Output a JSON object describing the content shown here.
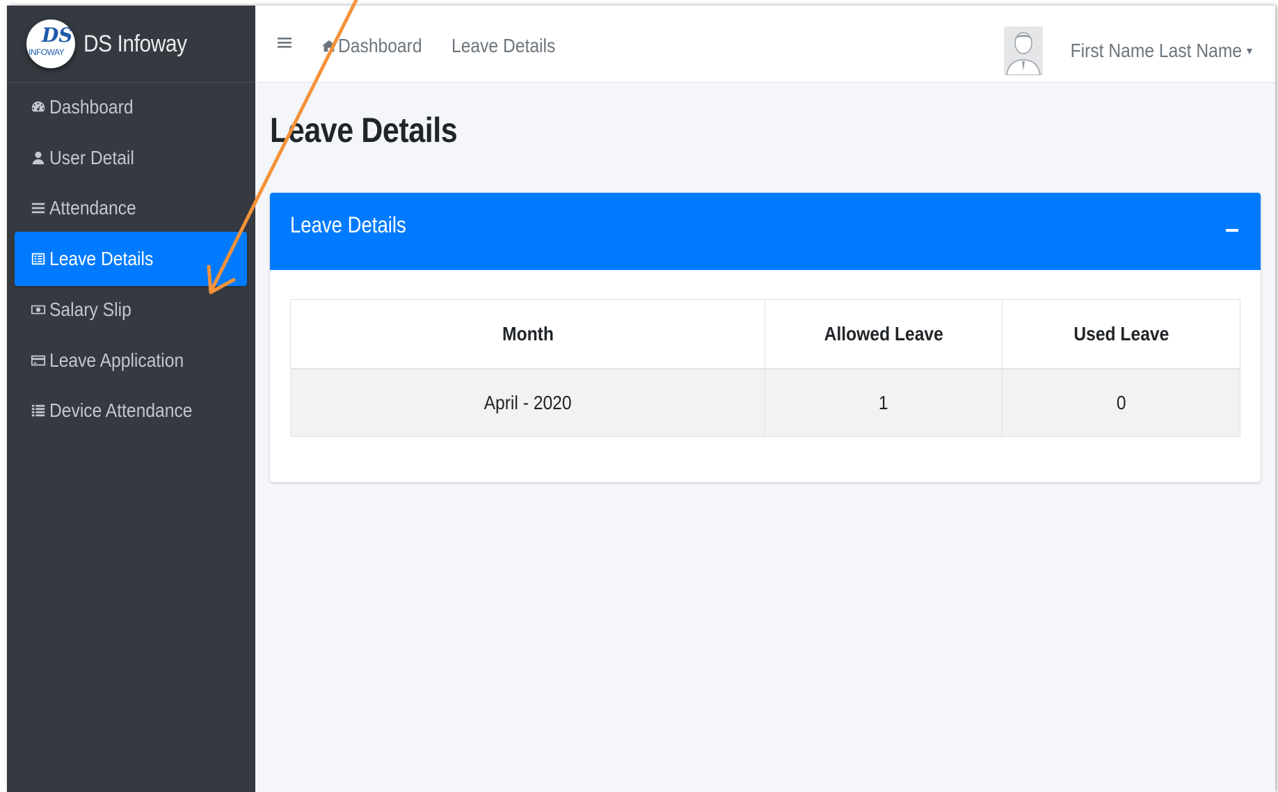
{
  "brand": {
    "name": "DS Infoway",
    "logo_top": "DS",
    "logo_bottom": "INFOWAY"
  },
  "sidebar": {
    "items": [
      {
        "label": "Dashboard",
        "icon": "tachometer-icon"
      },
      {
        "label": "User Detail",
        "icon": "user-icon"
      },
      {
        "label": "Attendance",
        "icon": "bars-icon"
      },
      {
        "label": "Leave Details",
        "icon": "list-alt-icon",
        "active": true
      },
      {
        "label": "Salary Slip",
        "icon": "money-bill-icon"
      },
      {
        "label": "Leave Application",
        "icon": "credit-card-icon"
      },
      {
        "label": "Device Attendance",
        "icon": "list-icon"
      }
    ]
  },
  "header": {
    "menu_icon": "hamburger-icon",
    "breadcrumb": {
      "home": "Dashboard",
      "current": "Leave Details"
    },
    "user_name": "First Name Last Name"
  },
  "main": {
    "title": "Leave Details",
    "card": {
      "title": "Leave Details",
      "table": {
        "columns": [
          "Month",
          "Allowed Leave",
          "Used Leave"
        ],
        "rows": [
          [
            "April - 2020",
            "1",
            "0"
          ]
        ]
      }
    }
  },
  "colors": {
    "sidebar_bg": "#343a40",
    "accent": "#007bff",
    "content_bg": "#f4f6f9",
    "annotation_arrow": "#f4923a"
  }
}
